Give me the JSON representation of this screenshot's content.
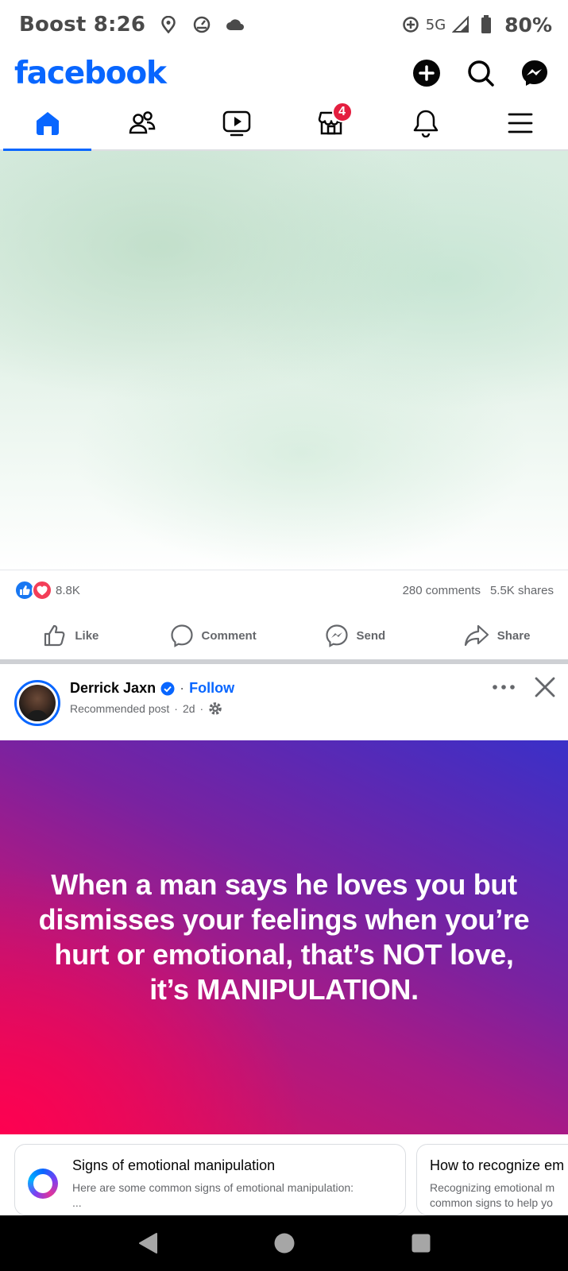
{
  "status_bar": {
    "carrier_time": "Boost 8:26",
    "network": "5G",
    "battery": "80%"
  },
  "header": {
    "logo": "facebook",
    "actions": [
      "plus-icon",
      "search-icon",
      "messenger-icon"
    ]
  },
  "nav_tabs": [
    {
      "icon": "home-icon",
      "active": true
    },
    {
      "icon": "friends-icon",
      "active": false
    },
    {
      "icon": "video-icon",
      "active": false
    },
    {
      "icon": "marketplace-icon",
      "active": false,
      "badge": "4"
    },
    {
      "icon": "bell-icon",
      "active": false
    },
    {
      "icon": "menu-icon",
      "active": false
    }
  ],
  "post1": {
    "reactions_count": "8.8K",
    "comments": "280 comments",
    "shares": "5.5K shares",
    "actions": {
      "like": "Like",
      "comment": "Comment",
      "send": "Send",
      "share": "Share"
    }
  },
  "post2": {
    "author": "Derrick Jaxn",
    "follow": "Follow",
    "subtitle": "Recommended post",
    "time": "2d",
    "quote": "When a man says he loves you but dismisses your feelings when you’re hurt or emotional, that’s NOT love, it’s MANIPULATION."
  },
  "related_cards": [
    {
      "title": "Signs of emotional manipulation",
      "description": "Here are some common signs of emotional manipulation:",
      "description_more": "..."
    },
    {
      "title": "How to recognize em",
      "description": "Recognizing emotional m",
      "description_more": "common signs to help yo"
    }
  ],
  "colors": {
    "brand": "#0866ff",
    "badge": "#e41e3f",
    "secondary_text": "#65676b"
  }
}
